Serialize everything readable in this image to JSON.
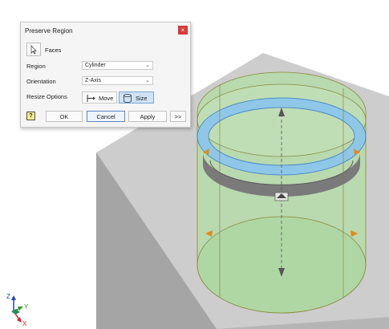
{
  "dialog": {
    "title": "Preserve Region",
    "close_icon": "close-icon",
    "faces_label": "Faces",
    "region_label": "Region",
    "region_value": "Cylinder",
    "orientation_label": "Orientation",
    "orientation_value": "Z-Axis",
    "resize_label": "Resize Options",
    "move_label": "Move",
    "size_label": "Size",
    "selected_resize_option": "Size",
    "help_icon": "help-icon",
    "ok_label": "OK",
    "cancel_label": "Cancel",
    "apply_label": "Apply",
    "expand_label": ">>"
  },
  "triad": {
    "z_label": "Z",
    "y_label": "Y",
    "x_label": "X",
    "colors": {
      "x": "#d62020",
      "y": "#2a9a2a",
      "z": "#2040c0"
    }
  },
  "colors": {
    "block_top": "#c9c9c9",
    "block_left": "#a6a6a6",
    "block_right": "#b8b8b8",
    "cylinder_fill": "#b8dcb0",
    "cylinder_edge": "#7a7a2a",
    "ring": "#8ecae6",
    "ring_edge": "#3c7fb3",
    "handle": "#e08a1a",
    "accent_button": "#cfe3f5"
  }
}
